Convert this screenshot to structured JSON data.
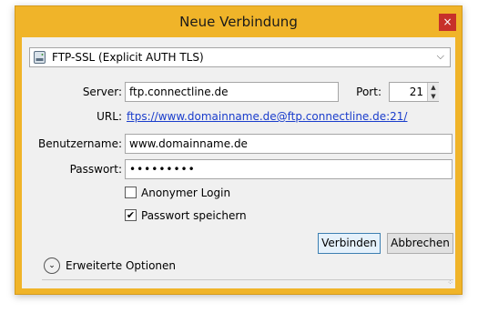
{
  "window": {
    "title": "Neue Verbindung",
    "close_label": "×"
  },
  "protocol": {
    "selected": "FTP-SSL (Explicit AUTH TLS)"
  },
  "server": {
    "label": "Server:",
    "value": "ftp.connectline.de"
  },
  "port": {
    "label": "Port:",
    "value": "21"
  },
  "url": {
    "label": "URL:",
    "link": "ftps://www.domainname.de@ftp.connectline.de:21/"
  },
  "username": {
    "label": "Benutzername:",
    "value": "www.domainname.de"
  },
  "password": {
    "label": "Passwort:",
    "masked": "•••••••••"
  },
  "anonymous": {
    "label": "Anonymer Login",
    "checked": false
  },
  "save_password": {
    "label": "Passwort speichern",
    "checked": true,
    "mark": "✔"
  },
  "buttons": {
    "connect": "Verbinden",
    "cancel": "Abbrechen"
  },
  "advanced": {
    "label": "Erweiterte Optionen",
    "icon": "⌄"
  },
  "colors": {
    "accent": "#f0b429",
    "link": "#1a3dcc",
    "close": "#c7302a"
  }
}
